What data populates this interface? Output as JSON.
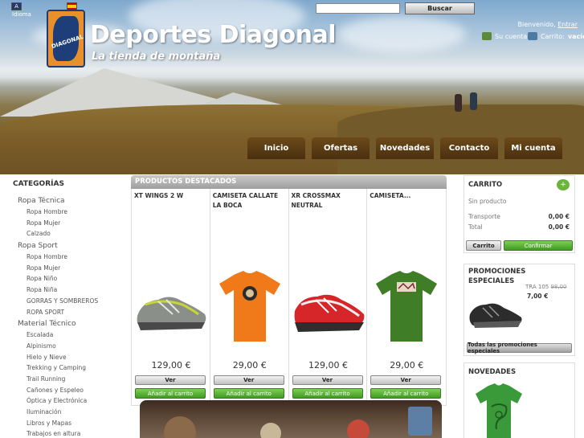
{
  "header": {
    "lang_label": "Idioma",
    "flag_a": "A",
    "site_title": "Deportes Diagonal",
    "tagline": "La tienda de montaña",
    "logo_text": "DIAGONAL",
    "search_placeholder": "",
    "search_button": "Buscar",
    "welcome_prefix": "Bienvenido, ",
    "login_link": "Entrar",
    "account_label": "Su cuenta",
    "cart_label": "Carrito:",
    "cart_status": "vacío"
  },
  "nav": {
    "items": [
      {
        "label": "Inicio"
      },
      {
        "label": "Ofertas"
      },
      {
        "label": "Novedades"
      },
      {
        "label": "Contacto"
      },
      {
        "label": "Mi cuenta"
      }
    ]
  },
  "categories": {
    "title": "CATEGORÍAS",
    "groups": [
      {
        "label": "Ropa Técnica",
        "items": [
          "Ropa Hombre",
          "Ropa Mujer",
          "Calzado"
        ]
      },
      {
        "label": "Ropa Sport",
        "items": [
          "Ropa Hombre",
          "Ropa Mujer",
          "Ropa Niño",
          "Ropa Niña",
          "GORRAS Y SOMBREROS",
          "ROPA SPORT"
        ]
      },
      {
        "label": "Material Técnico",
        "items": [
          "Escalada",
          "Alpinismo",
          "Hielo y Nieve",
          "Trekking y Camping",
          "Trail Running",
          "Cañones y Espeleo",
          "Óptica y Electrónica",
          "Iluminación",
          "Libros y Mapas",
          "Trabajos en altura"
        ]
      }
    ]
  },
  "featured": {
    "title": "PRODUCTOS DESTACADOS",
    "view_label": "Ver",
    "add_label": "Añadir al carrito",
    "products": [
      {
        "name": "XT WINGS 2 W",
        "price": "129,00 €",
        "kind": "shoe-grey"
      },
      {
        "name": "CAMISETA CALLATE LA BOCA",
        "price": "29,00 €",
        "kind": "shirt-orange"
      },
      {
        "name": "XR CROSSMAX NEUTRAL",
        "price": "129,00 €",
        "kind": "shoe-red"
      },
      {
        "name": "CAMISETA...",
        "price": "29,00 €",
        "kind": "shirt-green"
      }
    ]
  },
  "cart_box": {
    "title": "CARRITO",
    "empty_text": "Sin producto",
    "shipping_label": "Transporte",
    "shipping_value": "0,00 €",
    "total_label": "Total",
    "total_value": "0,00 €",
    "cart_button": "Carrito",
    "confirm_button": "Confirmar"
  },
  "promo_box": {
    "title_line1": "PROMOCIONES",
    "title_line2": "ESPECIALES",
    "product_name": "TRA 105",
    "old_price": "98,00",
    "new_price": "7,00 €",
    "all_button": "Todas las promociones especiales"
  },
  "new_box": {
    "title": "NOVEDADES"
  },
  "colors": {
    "nav_bg": "#5a3c14",
    "accent_green": "#4caf28",
    "shirt_orange": "#f07a1a",
    "shirt_green": "#3f7d26",
    "shoe_red": "#d6262a"
  }
}
